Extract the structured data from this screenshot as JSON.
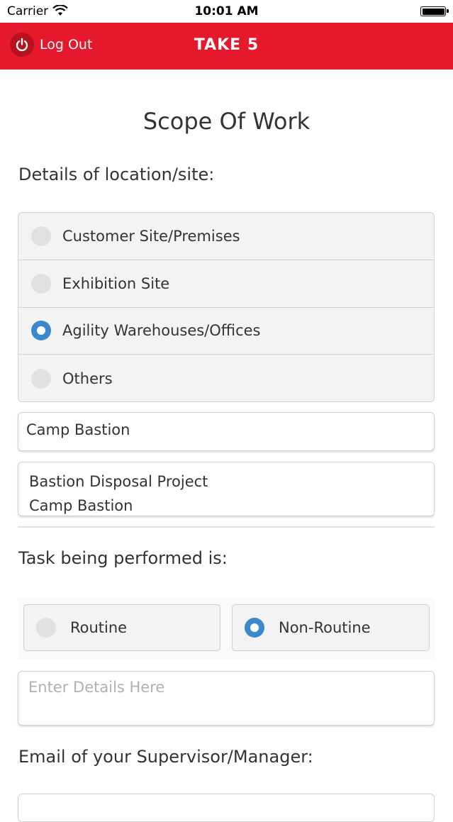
{
  "status_bar": {
    "carrier": "Carrier",
    "time": "10:01 AM"
  },
  "header": {
    "logout_label": "Log Out",
    "title": "TAKE 5",
    "color": "#e5192b"
  },
  "page": {
    "title": "Scope Of Work"
  },
  "location": {
    "label": "Details of location/site:",
    "options": [
      {
        "label": "Customer Site/Premises",
        "selected": false
      },
      {
        "label": "Exhibition Site",
        "selected": false
      },
      {
        "label": "Agility Warehouses/Offices",
        "selected": true
      },
      {
        "label": "Others",
        "selected": false
      }
    ],
    "site_value": "Camp Bastion",
    "description_lines": [
      "Bastion Disposal Project",
      "Camp Bastion"
    ]
  },
  "task": {
    "label": "Task being performed is:",
    "options": [
      {
        "label": "Routine",
        "selected": false
      },
      {
        "label": "Non-Routine",
        "selected": true
      }
    ],
    "details_placeholder": "Enter Details Here"
  },
  "email": {
    "label": "Email of your Supervisor/Manager:"
  },
  "colors": {
    "radio_selected": "#3b88cc",
    "radio_unselected": "#e1e1e1"
  }
}
